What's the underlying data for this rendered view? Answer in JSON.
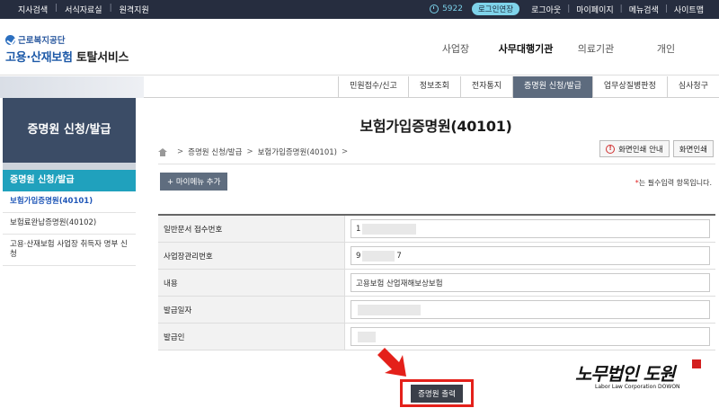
{
  "topbar": {
    "left_items": [
      "지사검색",
      "서식자료실",
      "원격지원"
    ],
    "timer": "5922",
    "extend_label": "로그인연장",
    "right_items": [
      "로그아웃",
      "마이페이지",
      "메뉴검색",
      "사이트맵"
    ]
  },
  "header": {
    "logo_sub": "근로복지공단",
    "logo_main_a": "고용·산재보험",
    "logo_main_b": "토탈서비스",
    "gnb": [
      "사업장",
      "사무대행기관",
      "의료기관",
      "개인"
    ],
    "gnb_active": "사무대행기관"
  },
  "subnav": {
    "tabs": [
      "민원접수/신고",
      "정보조회",
      "전자통지",
      "증명원 신청/발급",
      "업무상질병판정",
      "심사청구"
    ],
    "active": "증명원 신청/발급"
  },
  "sidebar": {
    "title": "증명원 신청/발급",
    "category": "증명원 신청/발급",
    "items": [
      "보험가입증명원(40101)",
      "보험료완납증명원(40102)",
      "고용·산재보험 사업장 취득자 명부 신청"
    ]
  },
  "main": {
    "title": "보험가입증명원(40101)",
    "breadcrumb": [
      "증명원 신청/발급",
      "보험가입증명원(40101)"
    ],
    "print_guide": "화면인쇄 안내",
    "print": "화면인쇄",
    "mymenu": "+ 마이메뉴 추가",
    "required_star": "*",
    "required_text": "는 필수입력 항목입니다."
  },
  "form": {
    "rows": [
      {
        "label": "일반문서 접수번호",
        "value": "1"
      },
      {
        "label": "사업장관리번호",
        "value_a": "9",
        "value_b": "7"
      },
      {
        "label": "내용",
        "value": "고용보험 산업재해보상보험"
      },
      {
        "label": "발급일자",
        "value": ""
      },
      {
        "label": "발급인",
        "value": ""
      }
    ]
  },
  "submit_label": "증명원 출력",
  "brand": {
    "main": "노무법인 도원",
    "sub": "Labor Law Corporation DOWON"
  }
}
